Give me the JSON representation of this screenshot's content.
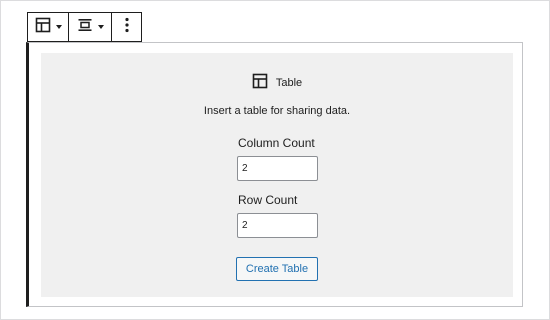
{
  "toolbar": {
    "items": [
      {
        "icon": "table-icon",
        "has_dropdown": true
      },
      {
        "icon": "align-center-icon",
        "has_dropdown": true
      },
      {
        "icon": "more-vertical-icon",
        "has_dropdown": false
      }
    ]
  },
  "placeholder": {
    "icon": "table-icon",
    "title": "Table",
    "description": "Insert a table for sharing data."
  },
  "form": {
    "column_label": "Column Count",
    "column_value": "2",
    "row_label": "Row Count",
    "row_value": "2",
    "submit_label": "Create Table"
  },
  "colors": {
    "text": "#1e1e1e",
    "accent": "#2271b1",
    "placeholder_bg": "#f0f0f0"
  }
}
